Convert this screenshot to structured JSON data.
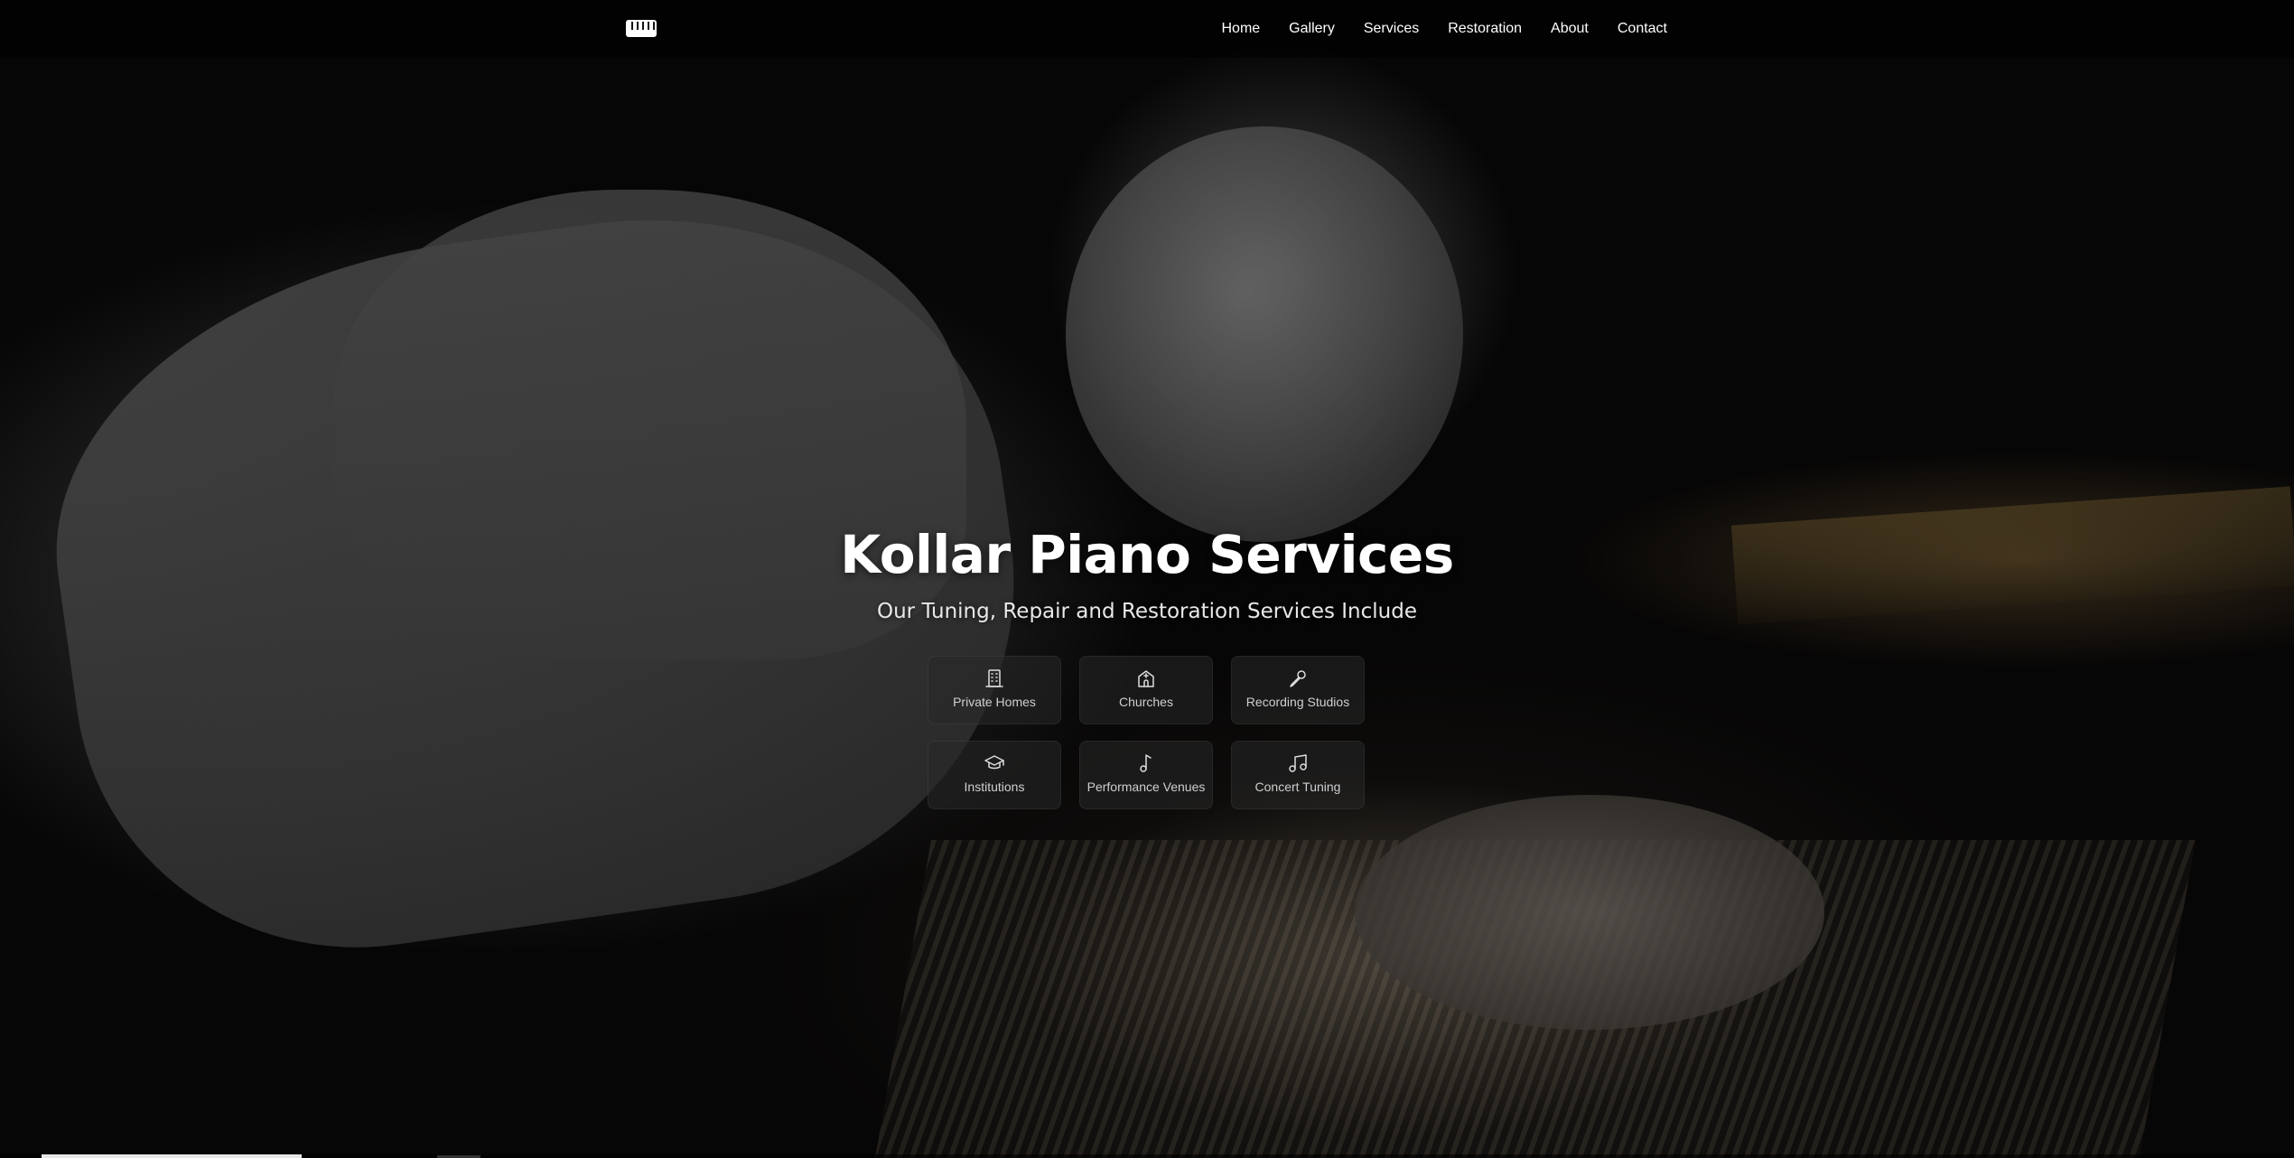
{
  "nav": {
    "logo_icon": "piano-keys-icon",
    "links": [
      {
        "label": "Home"
      },
      {
        "label": "Gallery"
      },
      {
        "label": "Services"
      },
      {
        "label": "Restoration"
      },
      {
        "label": "About"
      },
      {
        "label": "Contact"
      }
    ]
  },
  "hero": {
    "title": "Kollar Piano Services",
    "subtitle": "Our Tuning, Repair and Restoration Services Include",
    "services": [
      {
        "label": "Private Homes",
        "icon": "building-icon"
      },
      {
        "label": "Churches",
        "icon": "church-icon"
      },
      {
        "label": "Recording Studios",
        "icon": "microphone-icon"
      },
      {
        "label": "Institutions",
        "icon": "graduation-cap-icon"
      },
      {
        "label": "Performance Venues",
        "icon": "music-note-icon"
      },
      {
        "label": "Concert Tuning",
        "icon": "music-notes-icon"
      }
    ]
  },
  "colors": {
    "background": "#000000",
    "text": "#ffffff",
    "tile_bg": "#282828"
  }
}
